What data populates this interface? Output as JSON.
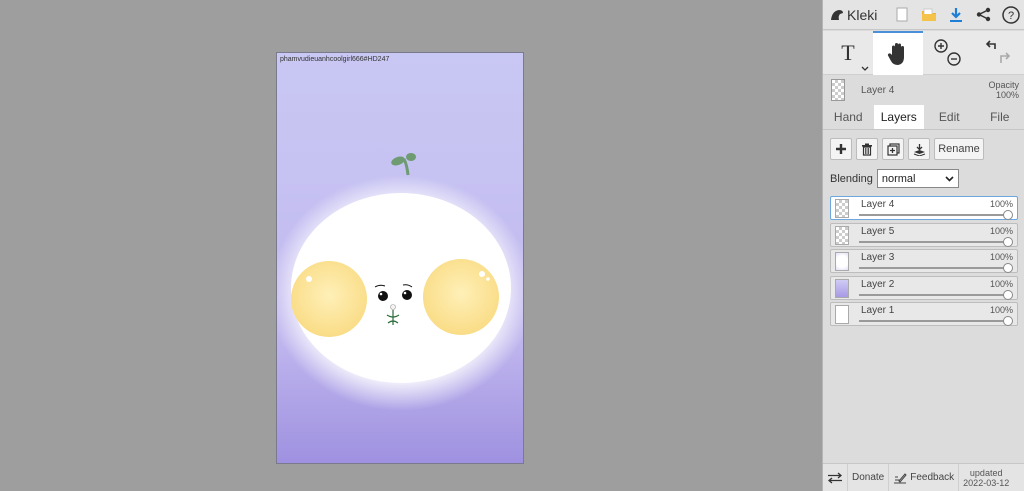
{
  "app": {
    "name": "Kleki"
  },
  "canvas": {
    "signature": "phamvudieuanhcoolgirl666#HD247"
  },
  "layer_info": {
    "name": "Layer 4",
    "opacity_label": "Opacity",
    "opacity_value": "100%"
  },
  "tabs": [
    {
      "label": "Hand",
      "active": false
    },
    {
      "label": "Layers",
      "active": true
    },
    {
      "label": "Edit",
      "active": false
    },
    {
      "label": "File",
      "active": false
    }
  ],
  "layer_buttons": {
    "rename": "Rename"
  },
  "blending": {
    "label": "Blending",
    "value": "normal"
  },
  "layers": [
    {
      "name": "Layer 4",
      "opacity": "100%",
      "selected": true,
      "fill": "checker"
    },
    {
      "name": "Layer 5",
      "opacity": "100%",
      "selected": false,
      "fill": "checker"
    },
    {
      "name": "Layer 3",
      "opacity": "100%",
      "selected": false,
      "fill": "white"
    },
    {
      "name": "Layer 2",
      "opacity": "100%",
      "selected": false,
      "fill": "purple"
    },
    {
      "name": "Layer 1",
      "opacity": "100%",
      "selected": false,
      "fill": "plain"
    }
  ],
  "footer": {
    "donate": "Donate",
    "feedback": "Feedback",
    "updated_label": "updated",
    "updated_date": "2022-03-12"
  },
  "colors": {
    "accent": "#4a90d9",
    "canvas_top": "#c9c7f3",
    "canvas_bottom": "#9f91e0",
    "cheek": "#fde59a"
  }
}
